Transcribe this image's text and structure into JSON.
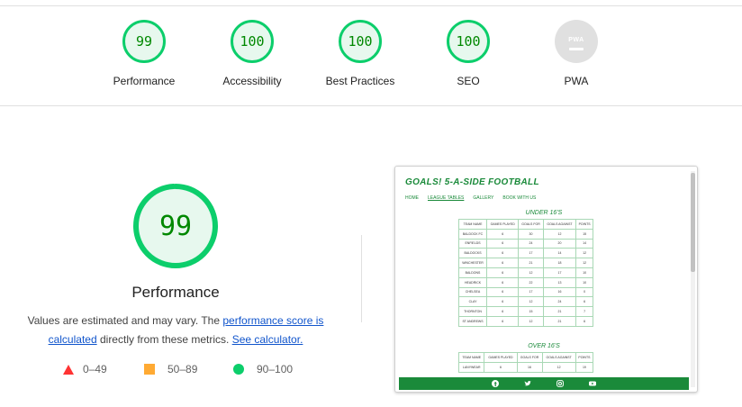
{
  "scores": [
    {
      "name": "performance",
      "value": "99",
      "label": "Performance"
    },
    {
      "name": "accessibility",
      "value": "100",
      "label": "Accessibility"
    },
    {
      "name": "best-practices",
      "value": "100",
      "label": "Best Practices"
    },
    {
      "name": "seo",
      "value": "100",
      "label": "SEO"
    },
    {
      "name": "pwa",
      "value": "PWA",
      "label": "PWA"
    }
  ],
  "main": {
    "score": "99",
    "score_fraction": 0.99,
    "title": "Performance",
    "desc_text_1": "Values are estimated and may vary. The ",
    "desc_link_1": "performance score is calculated",
    "desc_text_2": " directly from these metrics. ",
    "desc_link_2": "See calculator."
  },
  "legend": {
    "fail": "0–49",
    "average": "50–89",
    "pass": "90–100"
  },
  "colors": {
    "pass": "#0cce6b",
    "average": "#ffaa33",
    "fail": "#ff3333",
    "score_text": "#008800",
    "link": "#1155cc",
    "site_green": "#1a8a3a"
  },
  "screenshot": {
    "site_title": "GOALS! 5-A-SIDE FOOTBALL",
    "nav": [
      "HOME",
      "LEAGUE TABLES",
      "GALLERY",
      "BOOK WITH US"
    ],
    "section_1": "UNDER 16'S",
    "section_2": "OVER 16'S",
    "headers_1": [
      "TEAM NAME",
      "GAMES PLAYED",
      "GOALS FOR",
      "GOALS AGAINST",
      "POINTS"
    ],
    "rows_1": [
      [
        "BALDOCK FC",
        "6",
        "30",
        "12",
        "15"
      ],
      [
        "ENFIELDS",
        "6",
        "24",
        "20",
        "14"
      ],
      [
        "BALDOCKS",
        "6",
        "17",
        "14",
        "12"
      ],
      [
        "WINCHESTER",
        "6",
        "21",
        "18",
        "12"
      ],
      [
        "BALDONS",
        "6",
        "12",
        "17",
        "10"
      ],
      [
        "HEADRICK",
        "6",
        "22",
        "13",
        "10"
      ],
      [
        "CHELSEA",
        "6",
        "17",
        "16",
        "0"
      ],
      [
        "CLAY",
        "6",
        "12",
        "24",
        "6"
      ],
      [
        "THORNTON",
        "6",
        "15",
        "21",
        "7"
      ],
      [
        "ST ANDREWS",
        "6",
        "12",
        "21",
        "6"
      ]
    ],
    "headers_2": [
      "TEAM NAME",
      "GAMES PLAYED",
      "GOALS FOR",
      "GOALS AGAINST",
      "POINTS"
    ],
    "rows_2": [
      [
        "LANYWEAR",
        "6",
        "16",
        "12",
        "19"
      ]
    ],
    "footer_icons": [
      "facebook-icon",
      "twitter-icon",
      "instagram-icon",
      "youtube-icon"
    ]
  }
}
